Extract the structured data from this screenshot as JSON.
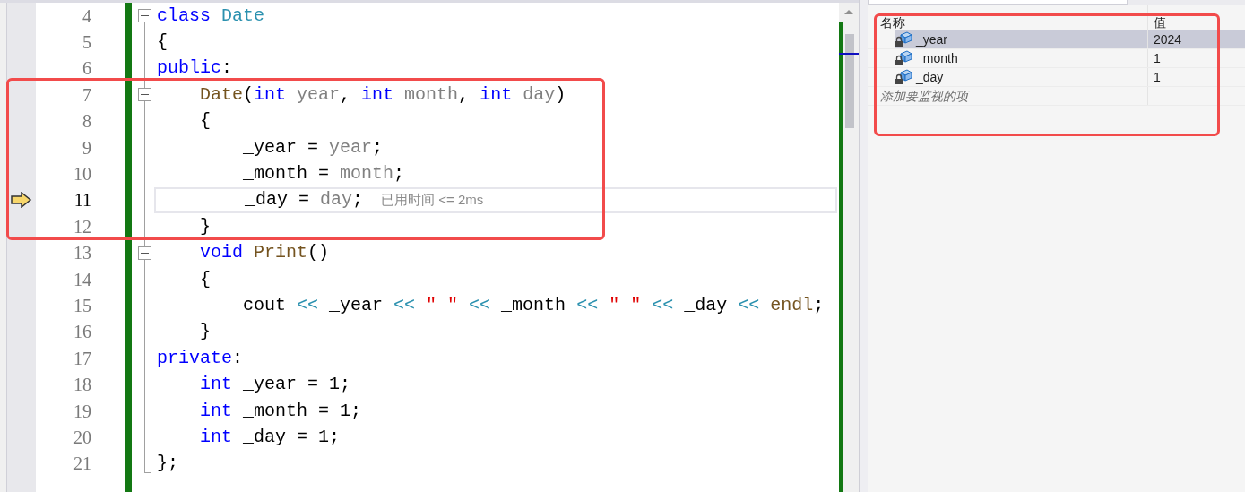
{
  "editor": {
    "lines": [
      {
        "number": "4",
        "expanded": true,
        "tokens": [
          {
            "t": "class ",
            "kind": "keyword"
          },
          {
            "t": "Date",
            "kind": "type"
          }
        ]
      },
      {
        "number": "5",
        "tokens": [
          {
            "t": "{",
            "kind": "plain"
          }
        ]
      },
      {
        "number": "6",
        "tokens": [
          {
            "t": "public",
            "kind": "keyword"
          },
          {
            "t": ":",
            "kind": "plain"
          }
        ]
      },
      {
        "number": "7",
        "expanded": true,
        "tokens": [
          {
            "t": "    Date",
            "kind": "func"
          },
          {
            "t": "(",
            "kind": "plain"
          },
          {
            "t": "int ",
            "kind": "keyword"
          },
          {
            "t": "year",
            "kind": "param"
          },
          {
            "t": ", ",
            "kind": "plain"
          },
          {
            "t": "int ",
            "kind": "keyword"
          },
          {
            "t": "month",
            "kind": "param"
          },
          {
            "t": ", ",
            "kind": "plain"
          },
          {
            "t": "int ",
            "kind": "keyword"
          },
          {
            "t": "day",
            "kind": "param"
          },
          {
            "t": ")",
            "kind": "plain"
          }
        ]
      },
      {
        "number": "8",
        "tokens": [
          {
            "t": "    {",
            "kind": "plain"
          }
        ]
      },
      {
        "number": "9",
        "tokens": [
          {
            "t": "        _year = ",
            "kind": "plain"
          },
          {
            "t": "year",
            "kind": "param"
          },
          {
            "t": ";",
            "kind": "plain"
          }
        ]
      },
      {
        "number": "10",
        "tokens": [
          {
            "t": "        _month = ",
            "kind": "plain"
          },
          {
            "t": "month",
            "kind": "param"
          },
          {
            "t": ";",
            "kind": "plain"
          }
        ]
      },
      {
        "number": "11",
        "current": true,
        "tokens": [
          {
            "t": "        _day = ",
            "kind": "plain"
          },
          {
            "t": "day",
            "kind": "param"
          },
          {
            "t": ";",
            "kind": "plain"
          },
          {
            "t": "已用时间 <= 2ms",
            "kind": "hint"
          }
        ]
      },
      {
        "number": "12",
        "tokens": [
          {
            "t": "    }",
            "kind": "plain"
          }
        ]
      },
      {
        "number": "13",
        "expanded": true,
        "tokens": [
          {
            "t": "    void ",
            "kind": "keyword"
          },
          {
            "t": "Print",
            "kind": "func"
          },
          {
            "t": "()",
            "kind": "plain"
          }
        ]
      },
      {
        "number": "14",
        "tokens": [
          {
            "t": "    {",
            "kind": "plain"
          }
        ]
      },
      {
        "number": "15",
        "tokens": [
          {
            "t": "        cout ",
            "kind": "plain"
          },
          {
            "t": "<< ",
            "kind": "op"
          },
          {
            "t": "_year ",
            "kind": "plain"
          },
          {
            "t": "<< ",
            "kind": "op"
          },
          {
            "t": "\" \" ",
            "kind": "string"
          },
          {
            "t": "<< ",
            "kind": "op"
          },
          {
            "t": "_month ",
            "kind": "plain"
          },
          {
            "t": "<< ",
            "kind": "op"
          },
          {
            "t": "\" \" ",
            "kind": "string"
          },
          {
            "t": "<< ",
            "kind": "op"
          },
          {
            "t": "_day ",
            "kind": "plain"
          },
          {
            "t": "<< ",
            "kind": "op"
          },
          {
            "t": "endl",
            "kind": "func"
          },
          {
            "t": ";",
            "kind": "plain"
          }
        ]
      },
      {
        "number": "16",
        "fold_end": true,
        "tokens": [
          {
            "t": "    }",
            "kind": "plain"
          }
        ]
      },
      {
        "number": "17",
        "tokens": [
          {
            "t": "private",
            "kind": "keyword"
          },
          {
            "t": ":",
            "kind": "plain"
          }
        ]
      },
      {
        "number": "18",
        "tokens": [
          {
            "t": "    int ",
            "kind": "keyword"
          },
          {
            "t": "_year = 1;",
            "kind": "plain"
          }
        ]
      },
      {
        "number": "19",
        "tokens": [
          {
            "t": "    int ",
            "kind": "keyword"
          },
          {
            "t": "_month = 1;",
            "kind": "plain"
          }
        ]
      },
      {
        "number": "20",
        "tokens": [
          {
            "t": "    int ",
            "kind": "keyword"
          },
          {
            "t": "_day = 1;",
            "kind": "plain"
          }
        ]
      },
      {
        "number": "21",
        "fold_end": true,
        "tokens": [
          {
            "t": "};",
            "kind": "plain"
          }
        ]
      }
    ]
  },
  "watch": {
    "columns": [
      "名称",
      "值"
    ],
    "rows": [
      {
        "name": "_year",
        "value": "2024",
        "selected": true
      },
      {
        "name": "_month",
        "value": "1",
        "selected": false
      },
      {
        "name": "_day",
        "value": "1",
        "selected": false
      }
    ],
    "placeholder": "添加要监视的项"
  }
}
